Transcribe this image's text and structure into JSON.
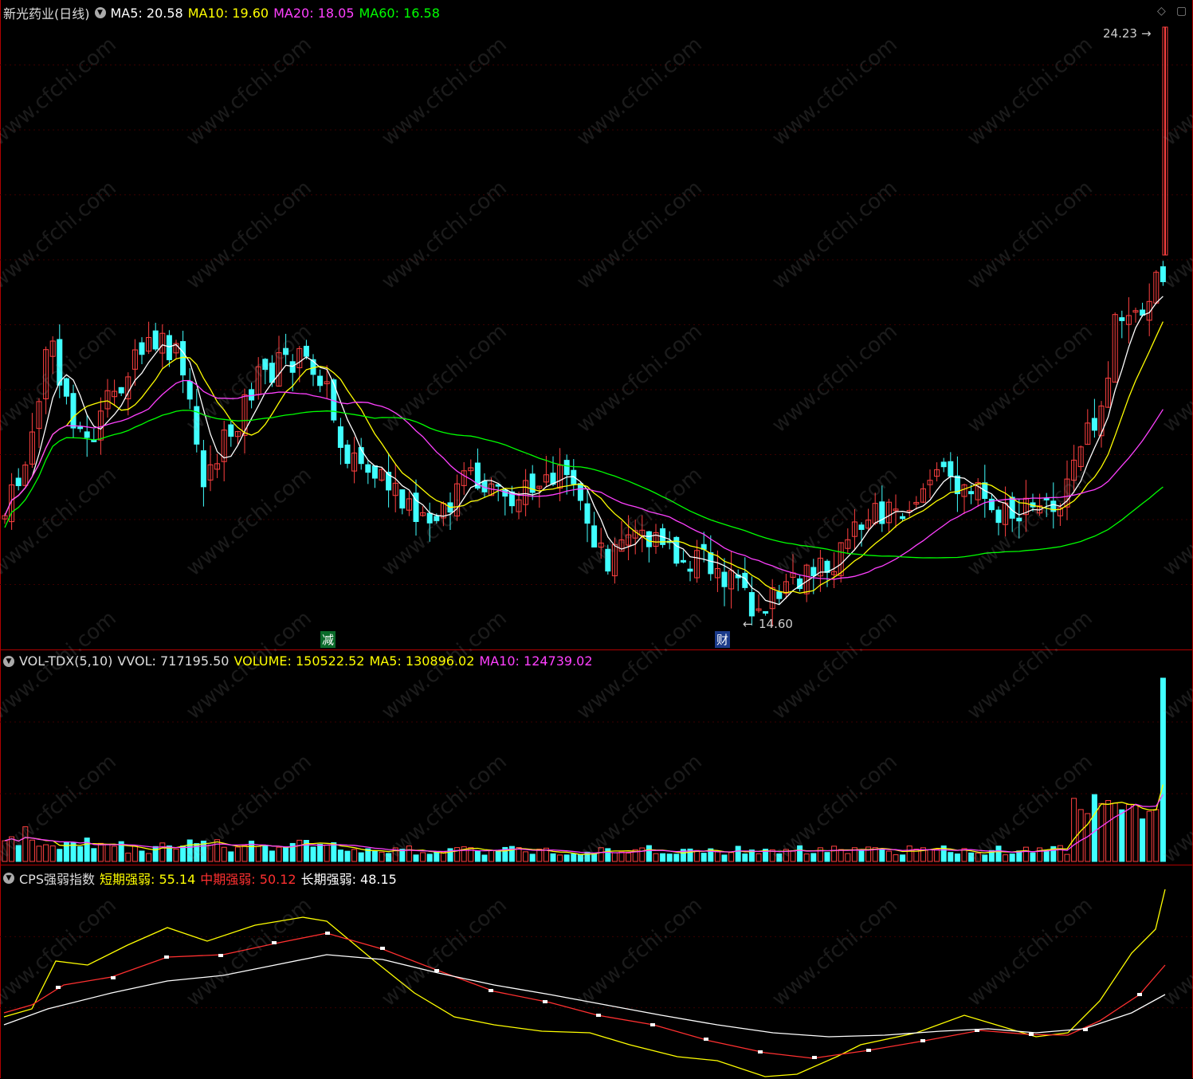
{
  "price": {
    "title": "新光药业(日线)",
    "ma5_label": "MA5: 20.58",
    "ma10_label": "MA10: 19.60",
    "ma20_label": "MA20: 18.05",
    "ma60_label": "MA60: 16.58",
    "high_marker": "24.23",
    "low_marker": "14.60",
    "tag_jian": "减",
    "tag_cai": "财",
    "colors": {
      "up": "#ff4040",
      "down": "#40ffff",
      "ma5": "#ffffff",
      "ma10": "#ffff00",
      "ma20": "#ff40ff",
      "ma60": "#00ff00"
    }
  },
  "volume": {
    "title": "VOL-TDX(5,10)",
    "vvol_label": "VVOL: 717195.50",
    "volume_label": "VOLUME: 150522.52",
    "ma5_label": "MA5: 130896.02",
    "ma10_label": "MA10: 124739.02"
  },
  "cps": {
    "title": "CPS强弱指数",
    "short_label": "短期强弱: 55.14",
    "mid_label": "中期强弱: 50.12",
    "long_label": "长期强弱: 48.15"
  },
  "watermark": "www.cfchi.com",
  "corner_icons": [
    "diamond-icon",
    "window-icon"
  ]
}
